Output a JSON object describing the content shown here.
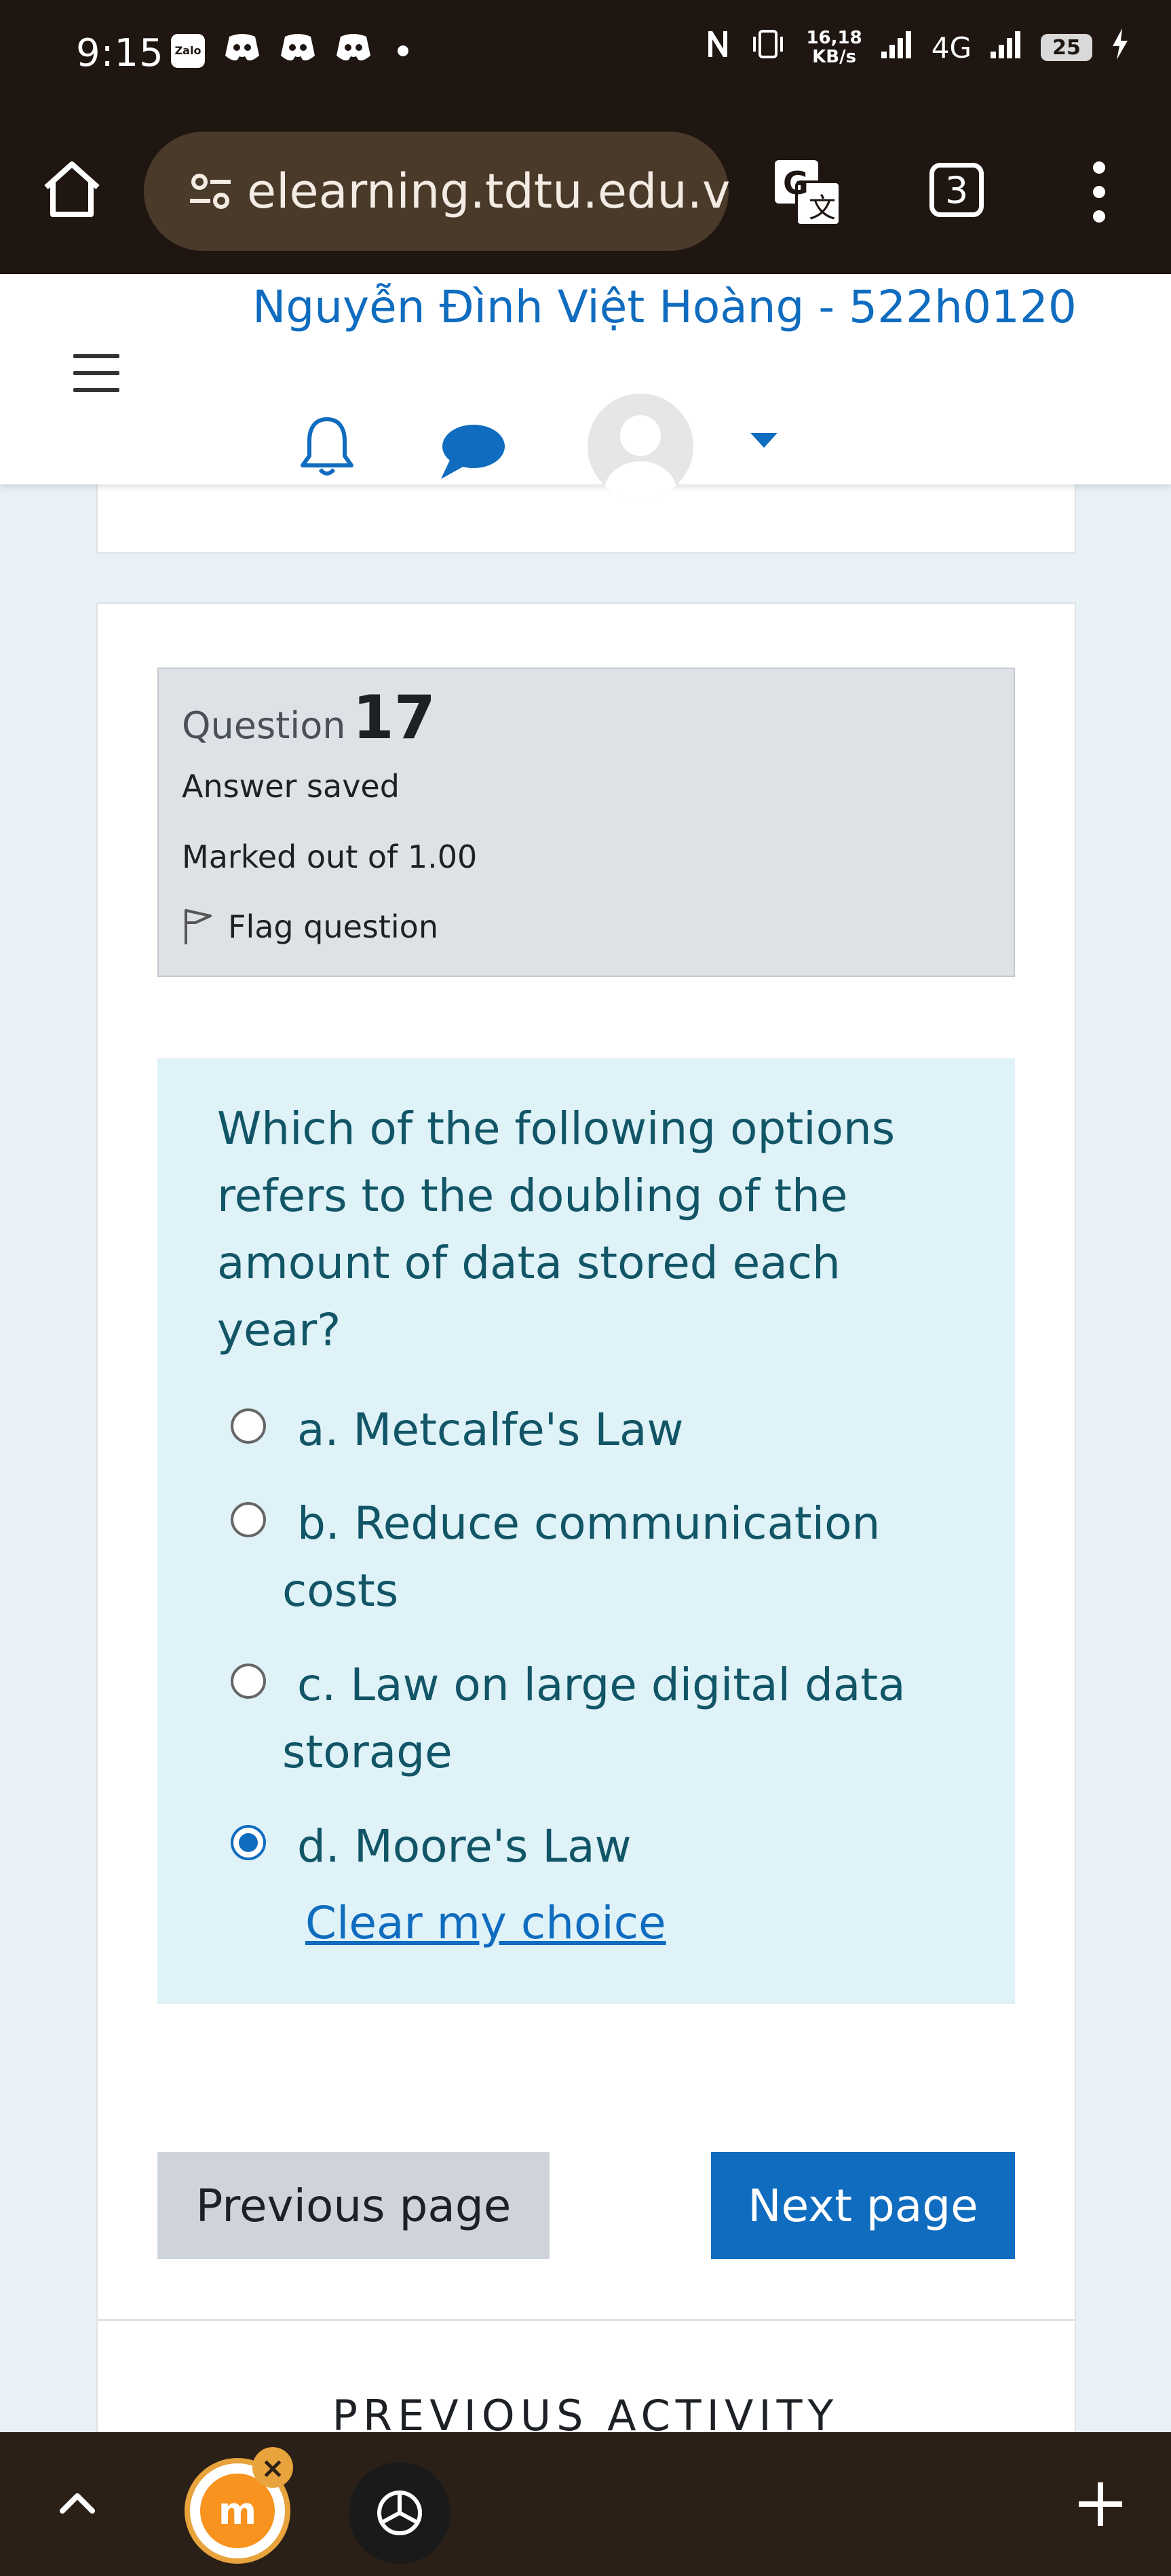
{
  "status_bar": {
    "time": "9:15",
    "left_icons": [
      "Zalo",
      "discord-icon",
      "discord-icon",
      "discord-icon",
      "dot"
    ],
    "zalo_label": "Zalo",
    "network_speed_value": "16,18",
    "network_speed_unit": "KB/s",
    "network_type": "4G",
    "battery_level": "25"
  },
  "browser": {
    "url": "elearning.tdtu.edu.vn/",
    "tab_count": "3"
  },
  "header": {
    "user_name": "Nguyễn Đình Việt Hoàng - 522h0120"
  },
  "question_info": {
    "label": "Question",
    "number": "17",
    "state": "Answer saved",
    "grade": "Marked out of 1.00",
    "flag_label": "Flag question"
  },
  "question": {
    "text": "Which of the following options refers to the doubling of the amount of data stored each year?",
    "answers": [
      {
        "label": "a. Metcalfe's Law",
        "selected": false
      },
      {
        "label": "b. Reduce communication costs",
        "selected": false
      },
      {
        "label": "c. Law on large digital data storage",
        "selected": false
      },
      {
        "label": "d. Moore's Law",
        "selected": true
      }
    ],
    "clear_label": "Clear my choice"
  },
  "navigation": {
    "previous_label": "Previous page",
    "next_label": "Next page",
    "previous_activity_label": "PREVIOUS ACTIVITY"
  },
  "colors": {
    "accent": "#0f6cbf",
    "question_bg": "#def2f8",
    "question_text": "#115566",
    "info_bg": "#dee2e6",
    "toolbar_bg": "#1f1612"
  }
}
